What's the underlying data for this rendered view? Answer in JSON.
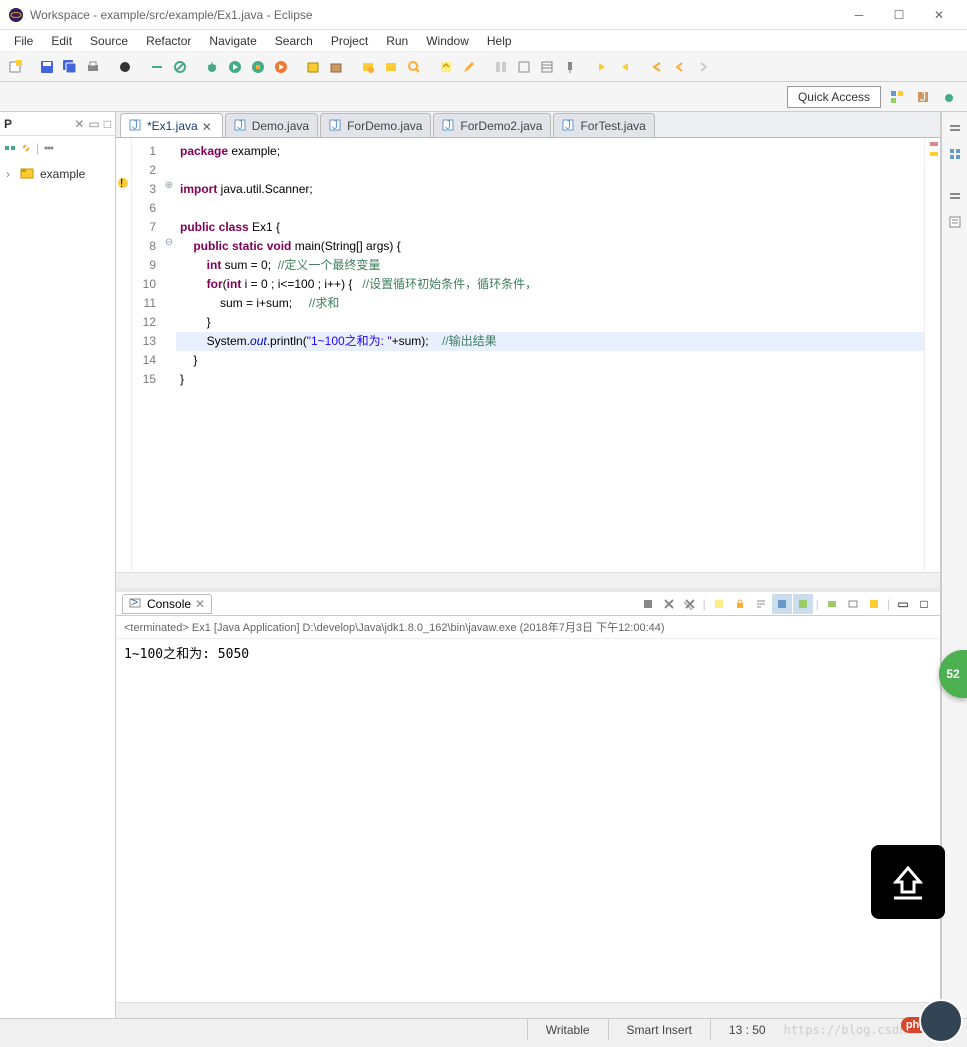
{
  "window": {
    "title": "Workspace - example/src/example/Ex1.java - Eclipse"
  },
  "menu": [
    "File",
    "Edit",
    "Source",
    "Refactor",
    "Navigate",
    "Search",
    "Project",
    "Run",
    "Window",
    "Help"
  ],
  "quick_access": "Quick Access",
  "project_view": {
    "label": "P",
    "tree_item": "example"
  },
  "tabs": [
    {
      "label": "*Ex1.java",
      "active": true
    },
    {
      "label": "Demo.java",
      "active": false
    },
    {
      "label": "ForDemo.java",
      "active": false
    },
    {
      "label": "ForDemo2.java",
      "active": false
    },
    {
      "label": "ForTest.java",
      "active": false
    }
  ],
  "code": {
    "lines": [
      {
        "n": "1",
        "tokens": [
          {
            "c": "kw",
            "t": "package"
          },
          {
            "c": "txt",
            "t": " example;"
          }
        ]
      },
      {
        "n": "2",
        "tokens": []
      },
      {
        "n": "3",
        "fold": "+",
        "tokens": [
          {
            "c": "kw",
            "t": "import"
          },
          {
            "c": "txt",
            "t": " java.util.Scanner;"
          }
        ]
      },
      {
        "n": "6",
        "tokens": []
      },
      {
        "n": "7",
        "tokens": [
          {
            "c": "kw",
            "t": "public class"
          },
          {
            "c": "txt",
            "t": " Ex1 {"
          }
        ]
      },
      {
        "n": "8",
        "fold": "-",
        "tokens": [
          {
            "c": "txt",
            "t": "    "
          },
          {
            "c": "kw",
            "t": "public static void"
          },
          {
            "c": "txt",
            "t": " main(String[] args) {"
          }
        ]
      },
      {
        "n": "9",
        "tokens": [
          {
            "c": "txt",
            "t": "        "
          },
          {
            "c": "kw",
            "t": "int"
          },
          {
            "c": "txt",
            "t": " sum = 0;  "
          },
          {
            "c": "cm",
            "t": "//定义一个最终变量"
          }
        ]
      },
      {
        "n": "10",
        "tokens": [
          {
            "c": "txt",
            "t": "        "
          },
          {
            "c": "kw",
            "t": "for"
          },
          {
            "c": "txt",
            "t": "("
          },
          {
            "c": "kw",
            "t": "int"
          },
          {
            "c": "txt",
            "t": " i = 0 ; i<=100 ; i++) {   "
          },
          {
            "c": "cm",
            "t": "//设置循环初始条件，循环条件，"
          }
        ]
      },
      {
        "n": "11",
        "tokens": [
          {
            "c": "txt",
            "t": "            sum = i+sum;     "
          },
          {
            "c": "cm",
            "t": "//求和"
          }
        ]
      },
      {
        "n": "12",
        "tokens": [
          {
            "c": "txt",
            "t": "        }"
          }
        ]
      },
      {
        "n": "13",
        "hl": true,
        "tokens": [
          {
            "c": "txt",
            "t": "        System."
          },
          {
            "c": "fld",
            "t": "out"
          },
          {
            "c": "txt",
            "t": ".println("
          },
          {
            "c": "st",
            "t": "\"1~100之和为: \""
          },
          {
            "c": "txt",
            "t": "+sum);    "
          },
          {
            "c": "cm",
            "t": "//输出结果"
          }
        ]
      },
      {
        "n": "14",
        "tokens": [
          {
            "c": "txt",
            "t": "    }"
          }
        ]
      },
      {
        "n": "15",
        "tokens": [
          {
            "c": "txt",
            "t": "}"
          }
        ]
      }
    ]
  },
  "console": {
    "tab": "Console",
    "info": "<terminated> Ex1 [Java Application] D:\\develop\\Java\\jdk1.8.0_162\\bin\\javaw.exe (2018年7月3日 下午12:00:44)",
    "output": "1~100之和为: 5050"
  },
  "status": {
    "writable": "Writable",
    "insert": "Smart Insert",
    "pos": "13 : 50",
    "watermark": "https://blog.csdn.net/an"
  },
  "float_badge": "52",
  "float_php": "php"
}
